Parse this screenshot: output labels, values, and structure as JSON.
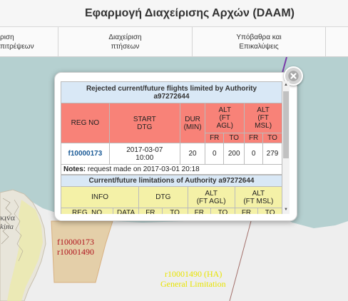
{
  "header": {
    "title": "Εφαρμογή Διαχείρισης Αρχών (DAAM)"
  },
  "nav": {
    "items": [
      {
        "label": "ριση\nπιτρέψεων"
      },
      {
        "label": "Διαχείριση\nπτήσεων"
      },
      {
        "label": "Υπόβαθρα και\nΕπικαλύψεις"
      }
    ]
  },
  "map": {
    "land_label_1": "κινα",
    "land_label_2": "kina",
    "zone_label_1": "f10000173",
    "zone_label_2": "r10001490",
    "limit_label_1": "r10001490 (HA)",
    "limit_label_2": "General Limitation",
    "colors": {
      "sea": "#b5d0d0",
      "land": "#eeeeee",
      "zone_fill": "#e2c99c",
      "zone_text": "#b0141e",
      "limit_text": "#e8e400"
    }
  },
  "popup": {
    "close_icon": "close-circle-icon",
    "rejected_title_line1": "Rejected current/future flights limited by Authority",
    "rejected_title_line2": "a97272644",
    "rejected_headers": {
      "reg_no": "REG NO",
      "start_dtg_1": "START",
      "start_dtg_2": "DTG",
      "dur_1": "DUR",
      "dur_2": "(MIN)",
      "alt_agl_1": "ALT",
      "alt_agl_2": "(FT",
      "alt_agl_3": "AGL)",
      "alt_msl_1": "ALT",
      "alt_msl_2": "(FT",
      "alt_msl_3": "MSL)",
      "fr": "FR",
      "to": "TO"
    },
    "rejected_row": {
      "reg_no": "f10000173",
      "start_date": "2017-03-07",
      "start_time": "10:00",
      "dur": "20",
      "agl_fr": "0",
      "agl_to": "200",
      "msl_fr": "0",
      "msl_to": "279"
    },
    "notes_label": "Notes:",
    "notes_text": " request made on 2017-03-01 20:18",
    "limits_title": "Current/future limitations of Authority a97272644",
    "limits_headers": {
      "info": "INFO",
      "dtg": "DTG",
      "alt_agl_1": "ALT",
      "alt_agl_2": "(FT AGL)",
      "alt_msl_1": "ALT",
      "alt_msl_2": "(FT MSL)",
      "reg_no": "REG_NO",
      "data": "DATA",
      "fr": "FR",
      "to": "TO"
    }
  }
}
